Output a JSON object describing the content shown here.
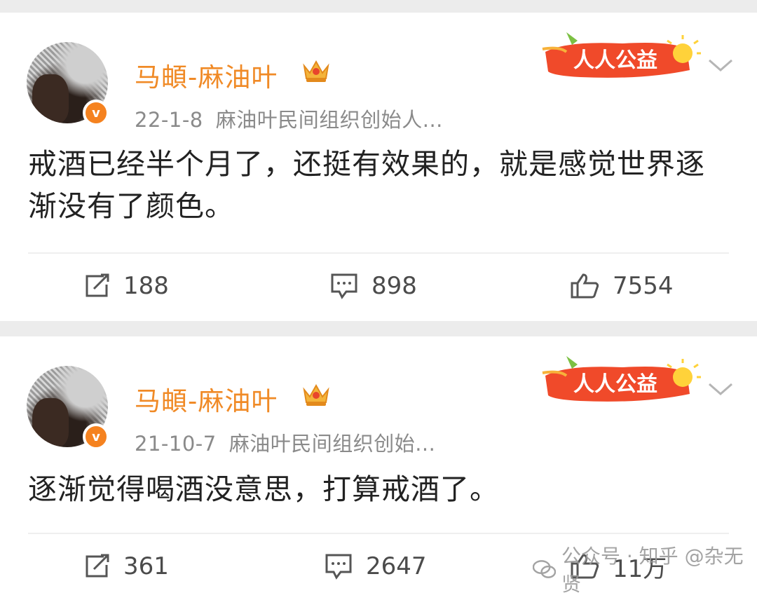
{
  "posts": [
    {
      "author": "马頔-麻油叶",
      "date": "22-1-8",
      "source": "麻油叶民间组织创始人...",
      "verified_badge": "v",
      "charity_label": "人人公益",
      "content": "戒酒已经半个月了，还挺有效果的，就是感觉世界逐渐没有了颜色。",
      "reposts": "188",
      "comments": "898",
      "likes": "7554"
    },
    {
      "author": "马頔-麻油叶",
      "date": "21-10-7",
      "source": "麻油叶民间组织创始...",
      "verified_badge": "v",
      "charity_label": "人人公益",
      "content": "逐渐觉得喝酒没意思，打算戒酒了。",
      "reposts": "361",
      "comments": "2647",
      "likes": "11万"
    }
  ],
  "watermark": "公众号 · 知乎 @杂无贤",
  "colors": {
    "name": "#f08a26",
    "verified": "#f5821f",
    "charity_bg": "#f04a2a",
    "meta": "#8a8a8a",
    "text": "#222222"
  },
  "icons": [
    "repost-icon",
    "comment-icon",
    "like-icon",
    "crown-icon",
    "chevron-down-icon",
    "wechat-icon"
  ]
}
